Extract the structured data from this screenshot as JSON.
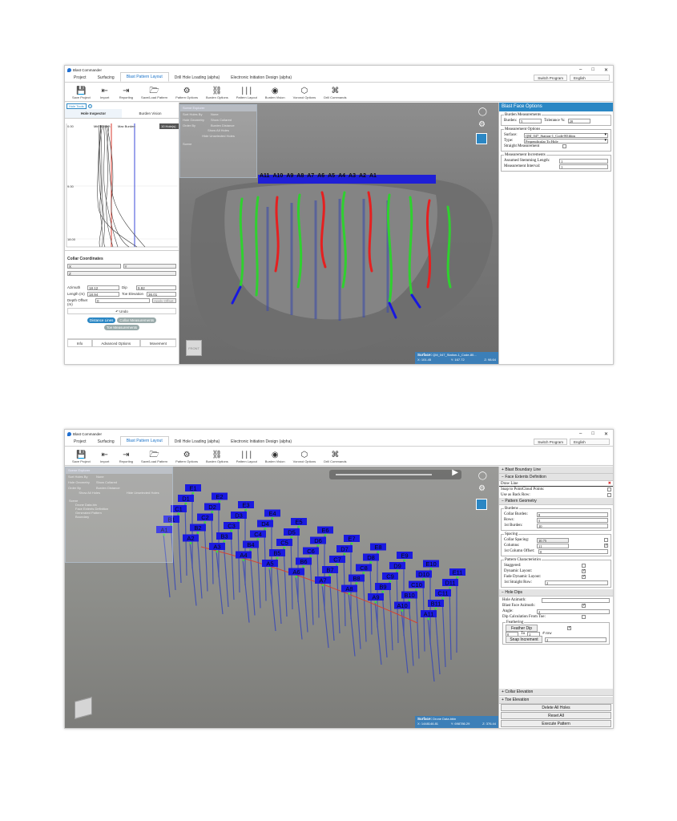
{
  "window1": {
    "title": "Blast Commander",
    "controls": [
      "–",
      "□",
      "✕"
    ],
    "menu_tabs": [
      "Project",
      "Surfacing",
      "Blast Pattern Layout",
      "Drill Hole Loading (alpha)",
      "Electronic Initiation Design (alpha)"
    ],
    "active_tab": "Blast Pattern Layout",
    "switch_program": "Switch Program",
    "language": "English",
    "ribbon": [
      "Save Project",
      "Import",
      "Reporting",
      "Save/Load Pattern",
      "Pattern Options",
      "Burden Options",
      "Pattern Layout",
      "Burden Vision",
      "Voronoi Options",
      "Drill Commands"
    ],
    "left_panel": {
      "tool_tab": "Hole Tools",
      "tabs": [
        "Hole Inspector",
        "Burden Vision"
      ],
      "chart_legend": [
        "Min Burden",
        "Max Burden"
      ],
      "holes_badge": "10 Hole(s)",
      "y_ticks": [
        "0.00",
        "9.00",
        "18.00"
      ],
      "collar_coordinates": "Collar Coordinates",
      "x_label": "X",
      "y_label": "Y",
      "z_label": "Z",
      "azimuth_label": "Azimuth",
      "azimuth_value": "18.12",
      "dip_label": "Dip",
      "dip_value": "9.92",
      "length_label": "Length (m)",
      "length_value": "18.94",
      "toe_elev_label": "Toe Elevation",
      "toe_elev_value": "36.01",
      "depth_offset_label": "Depth Offset (m)",
      "depth_offset_value": "0",
      "apply_offset": "Apply Offset",
      "undo": "Undo",
      "toggle_distance": "Distance Lines",
      "toggle_collar": "Collar Measurements",
      "toggle_toe": "Toe Measurements",
      "bottom_tabs": [
        "Info",
        "Advanced Options",
        "Movement"
      ]
    },
    "scene_explorer": {
      "title": "Scene Explorer",
      "rows": [
        [
          "Sort Holes By",
          "None"
        ],
        [
          "Hole Geometry",
          "Show Collared"
        ],
        [
          "Order By",
          "Burden Distance"
        ]
      ],
      "buttons": [
        "Show All Holes",
        "Hide Unselected Holes"
      ],
      "tree": "Scene"
    },
    "face_labels": [
      "A11",
      "A10",
      "A9",
      "A8",
      "A7",
      "A6",
      "A5",
      "A4",
      "A3",
      "A2",
      "A1"
    ],
    "front_label": "FRONT",
    "surface": {
      "label": "Surface:",
      "name": "QM_047_Station-1_Code-80...",
      "x": "X: 101.45",
      "y": "Y: 167.72",
      "z": "Z: 98.64"
    },
    "right_panel": {
      "title": "Blast Face Options",
      "burden_group": "Burden Measurements",
      "burden_label": "Burden:",
      "burden_value": "5",
      "tolerance_label": "Tolerance %:",
      "tolerance_value": "20",
      "measurement_group": "Measurement Options",
      "surface_label": "Surface:",
      "surface_value": "QM_047_Station-1_Code-80.bbin",
      "type_label": "Type:",
      "type_value": "Perpendicular To Hole",
      "straight_label": "Straight Measurement",
      "increments_group": "Measurement Increments",
      "stemming_label": "Assumed Stemming Length:",
      "stemming_value": "1",
      "interval_label": "Measurement Interval:",
      "interval_value": "1"
    }
  },
  "window2": {
    "title": "Blast Commander",
    "controls": [
      "–",
      "□",
      "✕"
    ],
    "menu_tabs": [
      "Project",
      "Surfacing",
      "Blast Pattern Layout",
      "Drill Hole Loading (alpha)",
      "Electronic Initiation Design (alpha)"
    ],
    "switch_program": "Switch Program",
    "language": "English",
    "ribbon": [
      "Save Project",
      "Import",
      "Reporting",
      "Save/Load Pattern",
      "Pattern Options",
      "Burden Options",
      "Pattern Layout",
      "Burden Vision",
      "Voronoi Options",
      "Drill Commands"
    ],
    "scene_explorer": {
      "title": "Scene Explorer",
      "rows": [
        [
          "Sort Holes By",
          "None"
        ],
        [
          "Hole Geometry",
          "Show Collared"
        ],
        [
          "Order By",
          "Burden Distance"
        ]
      ],
      "buttons": [
        "Show All Holes",
        "Hide Unselected Holes"
      ],
      "tree": [
        "Scene",
        "Drone Data.bin",
        "Face Extents Definition",
        "Generated Pattern",
        "Boundary"
      ]
    },
    "grid_rows": {
      "A": [
        "A1",
        "A2",
        "A3",
        "A4",
        "A5",
        "A6",
        "A7",
        "A8",
        "A9",
        "A10",
        "A11"
      ],
      "B": [
        "B1",
        "B2",
        "B3",
        "B4",
        "B5",
        "B6",
        "B7",
        "B8",
        "B9",
        "B10",
        "B11"
      ],
      "C": [
        "C1",
        "C2",
        "C3",
        "C4",
        "C5",
        "C6",
        "C7",
        "C8",
        "C9",
        "C10",
        "C11"
      ],
      "D": [
        "D1",
        "D2",
        "D3",
        "D4",
        "D5",
        "D6",
        "D7",
        "D8",
        "D9",
        "D10",
        "D11"
      ],
      "E": [
        "E1",
        "E2",
        "E3",
        "E4",
        "E5",
        "E6",
        "E7",
        "E8",
        "E9",
        "E10",
        "E11"
      ]
    },
    "surface": {
      "label": "Surface:",
      "name": "Drone Data.bbin",
      "x": "X: 1448146.81",
      "y": "Y: 698786.29",
      "z": "Z: 376.44"
    },
    "right_panel": {
      "sections_top": [
        "Blast Boundary Line",
        "Face Extents Definition"
      ],
      "draw_line": "Draw Line",
      "snap_label": "Snap to PointCloud Points:",
      "back_row_label": "Use as Back Row:",
      "pattern_geometry": "Pattern Geometry",
      "burdens_group": "Burdens",
      "collar_burden_label": "Collar Burden:",
      "collar_burden_value": "8",
      "rows_label": "Rows:",
      "rows_value": "5",
      "first_burden_label": "1st Burden:",
      "first_burden_value": "10",
      "spacing_group": "Spacing",
      "collar_spacing_label": "Collar Spacing:",
      "collar_spacing_value": "10.75",
      "columns_label": "Columns:",
      "columns_value": "11",
      "col_offset_label": "1st Column Offset:",
      "col_offset_value": "0",
      "characteristics_group": "Pattern Characteristics",
      "staggered_label": "Staggered:",
      "dynamic_label": "Dynamic Layout:",
      "fade_label": "Fade Dynamic Layout:",
      "straight_row_label": "1st Straight Row:",
      "straight_row_value": "2",
      "hole_dips": "Hole Dips",
      "hole_azimuth_label": "Hole Azimuth:",
      "blast_face_azimuth_label": "Blast Face Azimuth:",
      "angle_label": "Angle:",
      "angle_value": "2",
      "dip_calc_label": "Dip Calculation From Toe:",
      "feathering_group": "Feathering",
      "feather_dip": "Feather Dip",
      "feather_from": "0",
      "feather_to_label": "To",
      "feather_to": "2",
      "feather_row_label": "# row",
      "snap_increment": "Snap Increment",
      "snap_increment_value": "2",
      "collar_elevation": "Collar Elevation",
      "toe_elevation": "Toe Elevation",
      "delete_all": "Delete All Holes",
      "reset_all": "Reset All",
      "execute": "Execute Pattern"
    }
  }
}
